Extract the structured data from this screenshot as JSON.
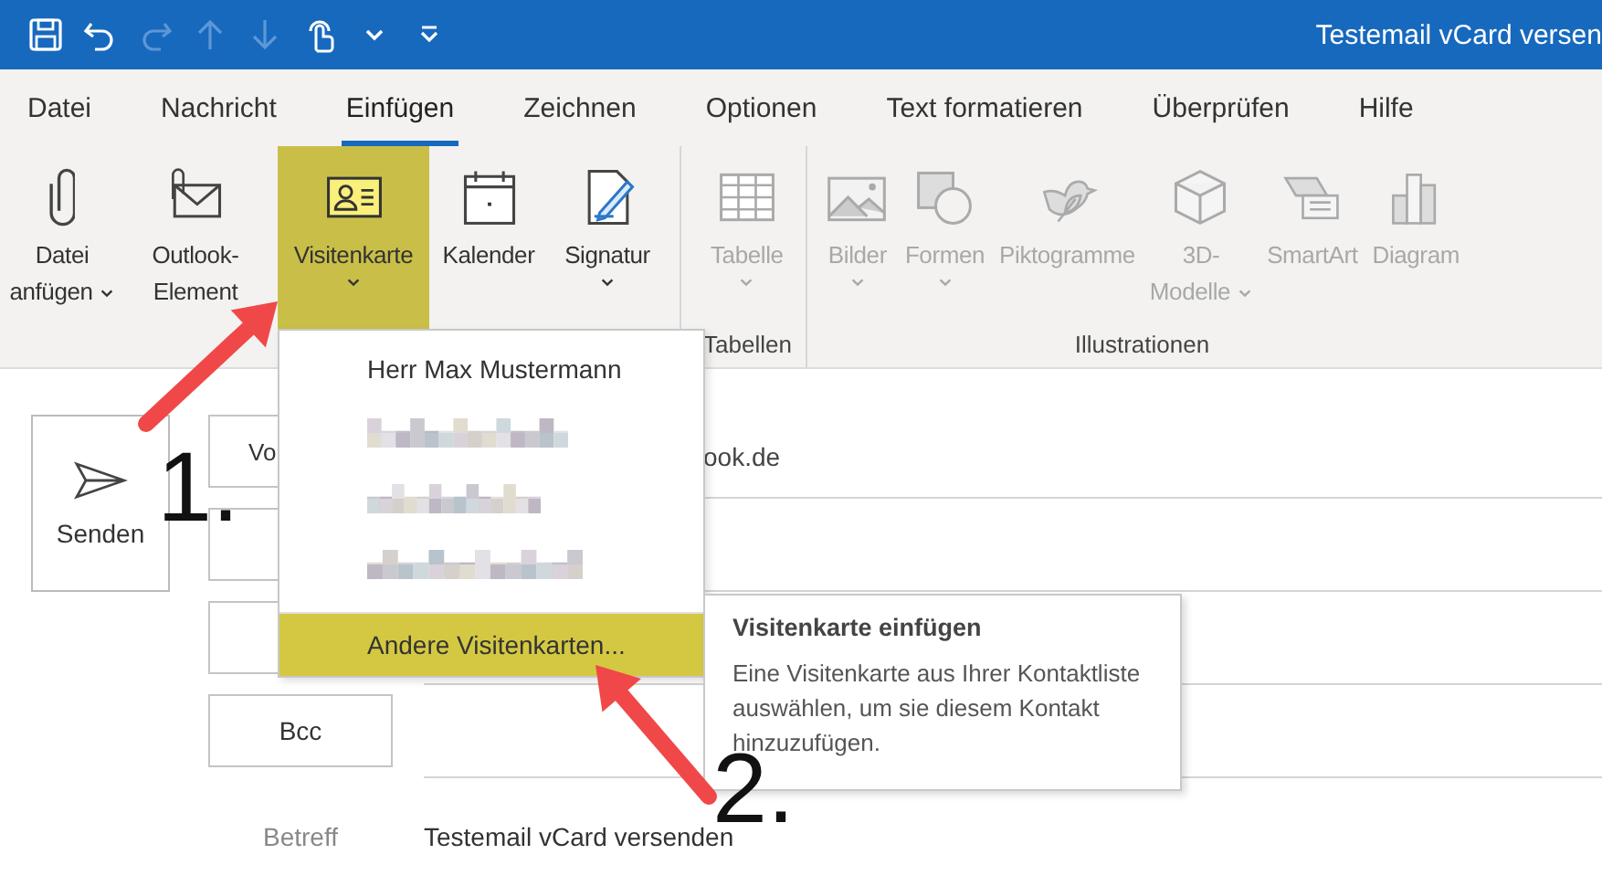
{
  "window": {
    "title": "Testemail vCard versen"
  },
  "quick_access": [
    {
      "kind": "save",
      "disabled": false
    },
    {
      "kind": "undo",
      "disabled": false
    },
    {
      "kind": "redo",
      "disabled": true
    },
    {
      "kind": "up",
      "disabled": true
    },
    {
      "kind": "down",
      "disabled": true
    },
    {
      "kind": "touch",
      "disabled": false
    },
    {
      "kind": "caret",
      "disabled": false
    },
    {
      "kind": "customize",
      "disabled": false
    }
  ],
  "tabs": [
    {
      "label": "Datei",
      "selected": false
    },
    {
      "label": "Nachricht",
      "selected": false
    },
    {
      "label": "Einfügen",
      "selected": true
    },
    {
      "label": "Zeichnen",
      "selected": false
    },
    {
      "label": "Optionen",
      "selected": false
    },
    {
      "label": "Text formatieren",
      "selected": false
    },
    {
      "label": "Überprüfen",
      "selected": false
    },
    {
      "label": "Hilfe",
      "selected": false
    }
  ],
  "ribbon": {
    "groups": [
      {
        "buttons": [
          {
            "kind": "attach",
            "lines": [
              "Datei",
              "anfügen"
            ],
            "dropdown": true,
            "caret_below": false,
            "disabled": false,
            "highlighted": false
          },
          {
            "kind": "item",
            "lines": [
              "Outlook-",
              "Element"
            ],
            "disabled": false,
            "highlighted": false
          },
          {
            "kind": "card",
            "lines": [
              "Visitenkarte"
            ],
            "dropdown": true,
            "caret_below": true,
            "disabled": false,
            "highlighted": true
          },
          {
            "kind": "calendar",
            "lines": [
              "Kalender"
            ],
            "disabled": false,
            "highlighted": false
          },
          {
            "kind": "signature",
            "lines": [
              "Signatur"
            ],
            "dropdown": true,
            "caret_below": true,
            "disabled": false,
            "highlighted": false
          }
        ]
      },
      {
        "label": "Tabellen",
        "buttons": [
          {
            "kind": "table",
            "lines": [
              "Tabelle"
            ],
            "dropdown": true,
            "caret_below": true,
            "disabled": true,
            "highlighted": false
          }
        ]
      },
      {
        "label": "Illustrationen",
        "buttons": [
          {
            "kind": "pictures",
            "lines": [
              "Bilder"
            ],
            "dropdown": true,
            "caret_below": true,
            "disabled": true,
            "highlighted": false
          },
          {
            "kind": "shapes",
            "lines": [
              "Formen"
            ],
            "dropdown": true,
            "caret_below": true,
            "disabled": true,
            "highlighted": false
          },
          {
            "kind": "icons",
            "lines": [
              "Piktogramme"
            ],
            "disabled": true,
            "highlighted": false
          },
          {
            "kind": "cube",
            "lines": [
              "3D-",
              "Modelle"
            ],
            "dropdown": true,
            "caret_below": false,
            "disabled": true,
            "highlighted": false
          },
          {
            "kind": "smartart",
            "lines": [
              "SmartArt"
            ],
            "disabled": true,
            "highlighted": false
          },
          {
            "kind": "chart",
            "lines": [
              "Diagram"
            ],
            "disabled": true,
            "highlighted": false
          }
        ]
      }
    ]
  },
  "compose": {
    "send_button": {
      "label": "Senden"
    },
    "fields": [
      {
        "kind": "from",
        "button_label": "Vo",
        "value": "ook.de"
      },
      {
        "kind": "to"
      },
      {
        "kind": "cc"
      },
      {
        "kind": "bcc",
        "button_label": "Bcc"
      }
    ],
    "subject": {
      "label": "Betreff",
      "value": "Testemail vCard versenden"
    }
  },
  "dropdown": {
    "items": [
      {
        "kind": "contact",
        "label": "Herr Max Mustermann",
        "selected": false
      },
      {
        "kind": "blurred",
        "selected": false
      },
      {
        "kind": "blurred",
        "selected": false
      },
      {
        "kind": "blurred",
        "selected": false
      },
      {
        "kind": "command",
        "label": "Andere Visitenkarten...",
        "selected": true
      }
    ]
  },
  "tooltip": {
    "title": "Visitenkarte einfügen",
    "text": "Eine Visitenkarte aus Ihrer Kontaktliste auswählen, um sie diesem Kontakt hinzuzufügen."
  },
  "annotations": [
    {
      "label": "1."
    },
    {
      "label": "2."
    }
  ]
}
